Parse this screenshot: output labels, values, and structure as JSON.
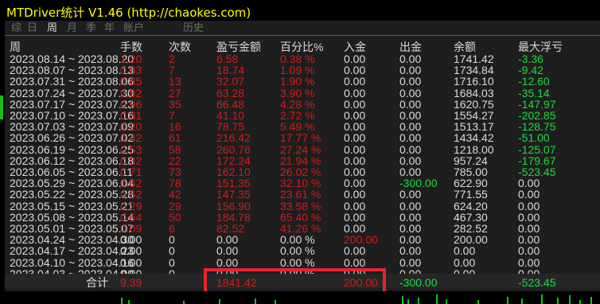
{
  "window": {
    "title": "MTDriver统计 V1.46  (http://chaokes.com)"
  },
  "tabs": [
    {
      "label": "综",
      "active": false
    },
    {
      "label": "日",
      "active": false
    },
    {
      "label": "周",
      "active": true
    },
    {
      "label": "月",
      "active": false
    },
    {
      "label": "季",
      "active": false
    },
    {
      "label": "年",
      "active": false
    },
    {
      "label": "账户",
      "active": false
    },
    {
      "label": "历史",
      "active": false
    }
  ],
  "table": {
    "headers": {
      "period": "周",
      "lots": "手数",
      "count": "次数",
      "pl": "盈亏金额",
      "pct": "百分比%",
      "deposit": "入金",
      "withdraw": "出金",
      "balance": "余额",
      "max_dd": "最大浮亏"
    },
    "rows": [
      {
        "period": "2023.08.14 ~ 2023.08.20",
        "lots": "1.20",
        "count": "2",
        "pl": "6.58",
        "pct": "0.38 %",
        "deposit": "0.00",
        "withdraw": "0.00",
        "balance": "1741.42",
        "max_dd": "-3.36"
      },
      {
        "period": "2023.08.07 ~ 2023.08.13",
        "lots": "0.83",
        "count": "7",
        "pl": "18.74",
        "pct": "1.09 %",
        "deposit": "0.00",
        "withdraw": "0.00",
        "balance": "1734.84",
        "max_dd": "-9.42"
      },
      {
        "period": "2023.07.31 ~ 2023.08.06",
        "lots": "0.85",
        "count": "13",
        "pl": "32.07",
        "pct": "1.90 %",
        "deposit": "0.00",
        "withdraw": "0.00",
        "balance": "1716.10",
        "max_dd": "-12.60"
      },
      {
        "period": "2023.07.24 ~ 2023.07.30",
        "lots": "0.82",
        "count": "27",
        "pl": "63.28",
        "pct": "3.90 %",
        "deposit": "0.00",
        "withdraw": "0.00",
        "balance": "1684.03",
        "max_dd": "-35.14"
      },
      {
        "period": "2023.07.17 ~ 2023.07.23",
        "lots": "0.96",
        "count": "35",
        "pl": "66.48",
        "pct": "4.28 %",
        "deposit": "0.00",
        "withdraw": "0.00",
        "balance": "1620.75",
        "max_dd": "-147.97"
      },
      {
        "period": "2023.07.10 ~ 2023.07.16",
        "lots": "0.31",
        "count": "7",
        "pl": "41.10",
        "pct": "2.72 %",
        "deposit": "0.00",
        "withdraw": "0.00",
        "balance": "1554.27",
        "max_dd": "-202.85"
      },
      {
        "period": "2023.07.03 ~ 2023.07.09",
        "lots": "0.20",
        "count": "16",
        "pl": "78.75",
        "pct": "5.49 %",
        "deposit": "0.00",
        "withdraw": "0.00",
        "balance": "1513.17",
        "max_dd": "-128.75"
      },
      {
        "period": "2023.06.26 ~ 2023.07.02",
        "lots": "0.42",
        "count": "61",
        "pl": "216.42",
        "pct": "17.77 %",
        "deposit": "0.00",
        "withdraw": "0.00",
        "balance": "1434.42",
        "max_dd": "-51.00"
      },
      {
        "period": "2023.06.19 ~ 2023.06.25",
        "lots": "0.53",
        "count": "58",
        "pl": "260.76",
        "pct": "27.24 %",
        "deposit": "0.00",
        "withdraw": "0.00",
        "balance": "1218.00",
        "max_dd": "-125.07"
      },
      {
        "period": "2023.06.12 ~ 2023.06.18",
        "lots": "0.32",
        "count": "22",
        "pl": "172.24",
        "pct": "21.94 %",
        "deposit": "0.00",
        "withdraw": "0.00",
        "balance": "957.24",
        "max_dd": "-179.67"
      },
      {
        "period": "2023.06.05 ~ 2023.06.11",
        "lots": "0.71",
        "count": "73",
        "pl": "162.10",
        "pct": "26.02 %",
        "deposit": "0.00",
        "withdraw": "0.00",
        "balance": "785.00",
        "max_dd": "-523.45"
      },
      {
        "period": "2023.05.29 ~ 2023.06.04",
        "lots": "0.62",
        "count": "78",
        "pl": "151.35",
        "pct": "32.10 %",
        "deposit": "0.00",
        "withdraw": "-300.00",
        "balance": "622.90",
        "max_dd": "0.00"
      },
      {
        "period": "2023.05.22 ~ 2023.05.28",
        "lots": "0.52",
        "count": "42",
        "pl": "147.35",
        "pct": "23.61 %",
        "deposit": "0.00",
        "withdraw": "0.00",
        "balance": "771.55",
        "max_dd": "0.00"
      },
      {
        "period": "2023.05.15 ~ 2023.05.21",
        "lots": "0.29",
        "count": "29",
        "pl": "156.90",
        "pct": "33.58 %",
        "deposit": "0.00",
        "withdraw": "0.00",
        "balance": "624.20",
        "max_dd": "0.00"
      },
      {
        "period": "2023.05.08 ~ 2023.05.14",
        "lots": "0.64",
        "count": "50",
        "pl": "184.78",
        "pct": "65.40 %",
        "deposit": "0.00",
        "withdraw": "0.00",
        "balance": "467.30",
        "max_dd": "0.00"
      },
      {
        "period": "2023.05.01 ~ 2023.05.07",
        "lots": "0.09",
        "count": "6",
        "pl": "82.52",
        "pct": "41.26 %",
        "deposit": "0.00",
        "withdraw": "0.00",
        "balance": "282.52",
        "max_dd": "0.00"
      },
      {
        "period": "2023.04.24 ~ 2023.04.30",
        "lots": "0.00",
        "count": "0",
        "pl": "0.00",
        "pct": "0.00 %",
        "deposit": "200.00",
        "withdraw": "0.00",
        "balance": "200.00",
        "max_dd": "0.00"
      },
      {
        "period": "2023.04.17 ~ 2023.04.23",
        "lots": "0.00",
        "count": "0",
        "pl": "0.00",
        "pct": "0.00 %",
        "deposit": "0.00",
        "withdraw": "0.00",
        "balance": "0.00",
        "max_dd": "0.00"
      },
      {
        "period": "2023.04.10 ~ 2023.04.16",
        "lots": "0.00",
        "count": "0",
        "pl": "0.00",
        "pct": "0.00 %",
        "deposit": "0.00",
        "withdraw": "0.00",
        "balance": "0.00",
        "max_dd": "0.00"
      },
      {
        "period": "2023.04.03 ~ 2023.04.09",
        "lots": "0.00",
        "count": "0",
        "pl": "0.00",
        "pct": "0.00 %",
        "deposit": "0.00",
        "withdraw": "0.00",
        "balance": "0.00",
        "max_dd": "0.00"
      }
    ],
    "total": {
      "label": "合计",
      "lots": "9.39",
      "pl": "1841.42",
      "deposit": "200.00",
      "withdraw": "-300.00",
      "max_dd": "-523.45"
    }
  },
  "colors": {
    "title": "#ffff00",
    "neutral": "#dcdcdc",
    "positive": "#d21c1c",
    "negative": "#1edc3c",
    "highlight_box": "#e8242d"
  }
}
